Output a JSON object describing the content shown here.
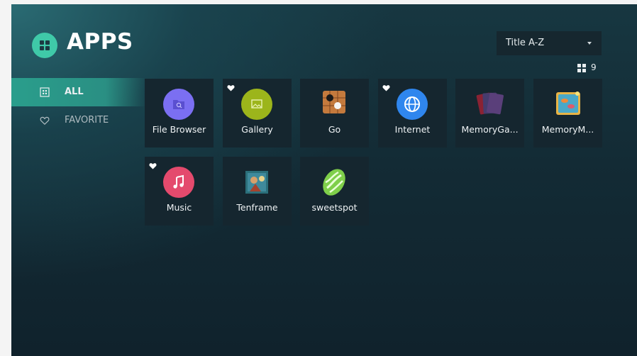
{
  "header": {
    "title": "APPS",
    "logo_icon": "grid-apps-icon"
  },
  "sort": {
    "selected": "Title A-Z"
  },
  "count": {
    "value": "9",
    "icon": "grid-view-icon"
  },
  "sidebar": {
    "items": [
      {
        "label": "ALL",
        "icon": "grid-icon",
        "active": true
      },
      {
        "label": "FAVORITE",
        "icon": "heart-outline-icon",
        "active": false
      }
    ]
  },
  "apps": [
    {
      "label": "File Browser",
      "icon": "folder-search-icon",
      "favorite": false,
      "color": "#7b6ff2"
    },
    {
      "label": "Gallery",
      "icon": "image-icon",
      "favorite": true,
      "color": "#9cb51b"
    },
    {
      "label": "Go",
      "icon": "go-board-icon",
      "favorite": false,
      "color": "#c47a3d"
    },
    {
      "label": "Internet",
      "icon": "globe-icon",
      "favorite": true,
      "color": "#2f86ee"
    },
    {
      "label": "MemoryGa...",
      "icon": "cards-icon",
      "favorite": false,
      "color": "#a33a54"
    },
    {
      "label": "MemoryM...",
      "icon": "memory-fish-icon",
      "favorite": false,
      "color": "#e8b446"
    },
    {
      "label": "Music",
      "icon": "music-note-icon",
      "favorite": true,
      "color": "#e44a6d"
    },
    {
      "label": "Tenframe",
      "icon": "tenframe-picture-icon",
      "favorite": false,
      "color": "#2b6f7a"
    },
    {
      "label": "sweetspot",
      "icon": "candy-icon",
      "favorite": false,
      "color": "#7fcf4a"
    }
  ]
}
